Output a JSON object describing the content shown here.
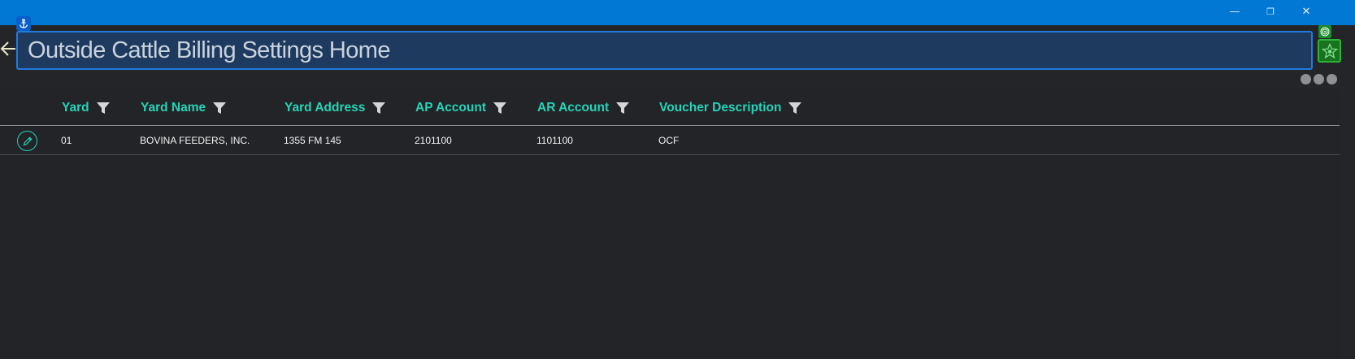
{
  "window": {
    "minimize_glyph": "—",
    "restore_glyph": "❐",
    "close_glyph": "✕"
  },
  "header": {
    "title": "Outside Cattle Billing Settings Home"
  },
  "icons": {
    "anchor": "anchor-icon",
    "back": "back-arrow-icon",
    "target": "target-icon",
    "star": "star-icon",
    "more": "more-dots-icon",
    "filter": "filter-icon",
    "edit": "pencil-icon"
  },
  "colors": {
    "titlebar": "#0078d4",
    "accent_teal": "#27d3b7",
    "title_box_bg": "#1e3a5f",
    "green_button": "#18721f"
  },
  "table": {
    "columns": [
      "Yard",
      "Yard Name",
      "Yard Address",
      "AP Account",
      "AR Account",
      "Voucher Description"
    ],
    "rows": [
      {
        "yard": "01",
        "yard_name": "BOVINA FEEDERS, INC.",
        "yard_address": "1355 FM 145",
        "ap_account": "2101100",
        "ar_account": "1101100",
        "voucher_description": "OCF"
      }
    ]
  }
}
